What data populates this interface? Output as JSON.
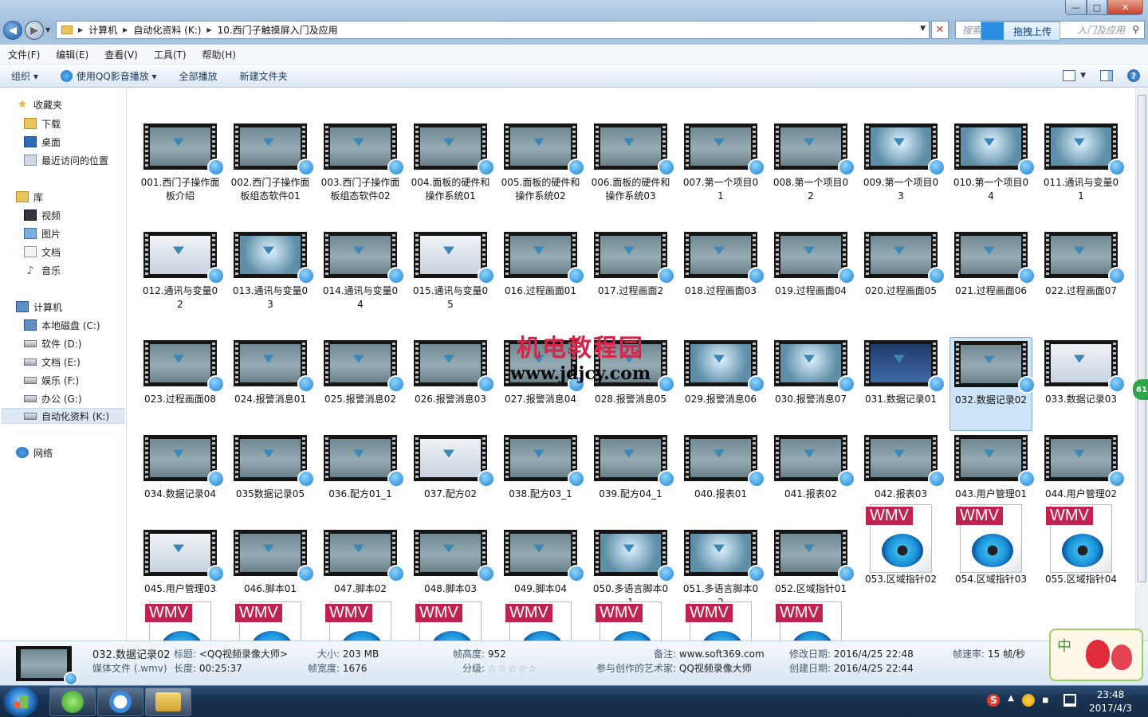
{
  "window": {
    "breadcrumb": [
      "计算机",
      "自动化资料 (K:)",
      "10.西门子触摸屏入门及应用"
    ],
    "search_placeholder": "搜索",
    "search_partial": "入门及应用",
    "upload_button": "拖拽上传",
    "controls": {
      "minimize": "—",
      "maximize": "□",
      "close": "✕"
    }
  },
  "menubar": [
    "文件(F)",
    "编辑(E)",
    "查看(V)",
    "工具(T)",
    "帮助(H)"
  ],
  "cmdbar": {
    "organize": "组织 ▾",
    "qq_play": "使用QQ影音播放 ▾",
    "play_all": "全部播放",
    "new_folder": "新建文件夹"
  },
  "navpane": {
    "favorites": {
      "label": "收藏夹",
      "items": [
        "下载",
        "桌面",
        "最近访问的位置"
      ]
    },
    "libraries": {
      "label": "库",
      "items": [
        "视频",
        "图片",
        "文档",
        "音乐"
      ]
    },
    "computer": {
      "label": "计算机",
      "items": [
        "本地磁盘 (C:)",
        "软件 (D:)",
        "文档 (E:)",
        "娱乐 (F:)",
        "办公 (G:)",
        "自动化资料 (K:)"
      ]
    },
    "network": {
      "label": "网络"
    }
  },
  "files": [
    {
      "name": "001.西门子操作面板介绍",
      "kind": "video"
    },
    {
      "name": "002.西门子操作面板组态软件01",
      "kind": "video"
    },
    {
      "name": "003.西门子操作面板组态软件02",
      "kind": "video"
    },
    {
      "name": "004.面板的硬件和操作系统01",
      "kind": "video"
    },
    {
      "name": "005.面板的硬件和操作系统02",
      "kind": "video"
    },
    {
      "name": "006.面板的硬件和操作系统03",
      "kind": "video"
    },
    {
      "name": "007.第一个项目01",
      "kind": "video"
    },
    {
      "name": "008.第一个项目02",
      "kind": "video"
    },
    {
      "name": "009.第一个项目03",
      "kind": "diamond"
    },
    {
      "name": "010.第一个项目04",
      "kind": "diamond"
    },
    {
      "name": "011.通讯与变量01",
      "kind": "diamond"
    },
    {
      "name": "012.通讯与变量02",
      "kind": "shot"
    },
    {
      "name": "013.通讯与变量03",
      "kind": "diamond"
    },
    {
      "name": "014.通讯与变量04",
      "kind": "video"
    },
    {
      "name": "015.通讯与变量05",
      "kind": "shot"
    },
    {
      "name": "016.过程画面01",
      "kind": "video"
    },
    {
      "name": "017.过程画面2",
      "kind": "video"
    },
    {
      "name": "018.过程画面03",
      "kind": "video"
    },
    {
      "name": "019.过程画面04",
      "kind": "video"
    },
    {
      "name": "020.过程画面05",
      "kind": "video"
    },
    {
      "name": "021.过程画面06",
      "kind": "video"
    },
    {
      "name": "022.过程画面07",
      "kind": "video"
    },
    {
      "name": "023.过程画面08",
      "kind": "video"
    },
    {
      "name": "024.报警消息01",
      "kind": "video"
    },
    {
      "name": "025.报警消息02",
      "kind": "video"
    },
    {
      "name": "026.报警消息03",
      "kind": "video"
    },
    {
      "name": "027.报警消息04",
      "kind": "video"
    },
    {
      "name": "028.报警消息05",
      "kind": "video"
    },
    {
      "name": "029.报警消息06",
      "kind": "diamond"
    },
    {
      "name": "030.报警消息07",
      "kind": "diamond"
    },
    {
      "name": "031.数据记录01",
      "kind": "dark"
    },
    {
      "name": "032.数据记录02",
      "kind": "video",
      "selected": true
    },
    {
      "name": "033.数据记录03",
      "kind": "shot"
    },
    {
      "name": "034.数据记录04",
      "kind": "video"
    },
    {
      "name": "035数据记录05",
      "kind": "video"
    },
    {
      "name": "036.配方01_1",
      "kind": "video"
    },
    {
      "name": "037.配方02",
      "kind": "shot"
    },
    {
      "name": "038.配方03_1",
      "kind": "video"
    },
    {
      "name": "039.配方04_1",
      "kind": "video"
    },
    {
      "name": "040.报表01",
      "kind": "video"
    },
    {
      "name": "041.报表02",
      "kind": "video"
    },
    {
      "name": "042.报表03",
      "kind": "video"
    },
    {
      "name": "043.用户管理01",
      "kind": "video"
    },
    {
      "name": "044.用户管理02",
      "kind": "video"
    },
    {
      "name": "045.用户管理03",
      "kind": "shot"
    },
    {
      "name": "046.脚本01",
      "kind": "video"
    },
    {
      "name": "047.脚本02",
      "kind": "video"
    },
    {
      "name": "048.脚本03",
      "kind": "video"
    },
    {
      "name": "049.脚本04",
      "kind": "video"
    },
    {
      "name": "050.多语言脚本01",
      "kind": "diamond"
    },
    {
      "name": "051.多语言脚本02",
      "kind": "diamond"
    },
    {
      "name": "052.区域指针01",
      "kind": "video"
    },
    {
      "name": "053.区域指针02",
      "kind": "wmv"
    },
    {
      "name": "054.区域指针03",
      "kind": "wmv"
    },
    {
      "name": "055.区域指针04",
      "kind": "wmv"
    },
    {
      "name": "",
      "kind": "wmv"
    },
    {
      "name": "",
      "kind": "wmv"
    },
    {
      "name": "",
      "kind": "wmv"
    },
    {
      "name": "",
      "kind": "wmv"
    },
    {
      "name": "",
      "kind": "wmv"
    },
    {
      "name": "",
      "kind": "wmv"
    },
    {
      "name": "",
      "kind": "wmv"
    },
    {
      "name": "",
      "kind": "wmv"
    }
  ],
  "wmv_tag": "WMV",
  "watermark": {
    "title": "机电教程园",
    "url": "www.jdjcy.com"
  },
  "side_badge": "61",
  "details": {
    "name": "032.数据记录02",
    "type": "媒体文件 (.wmv)",
    "title_label": "标题:",
    "title_value": "<QQ视频录像大师>",
    "length_label": "长度:",
    "length_value": "00:25:37",
    "size_label": "大小:",
    "size_value": "203 MB",
    "frame_width_label": "帧宽度:",
    "frame_width_value": "1676",
    "frame_height_label": "帧高度:",
    "frame_height_value": "952",
    "rating_label": "分级:",
    "rating_stars": "☆☆☆☆☆",
    "comment_label": "备注:",
    "comment_value": "www.soft369.com",
    "artist_label": "参与创作的艺术家:",
    "artist_value": "QQ视频录像大师",
    "modified_label": "修改日期:",
    "modified_value": "2016/4/25 22:48",
    "created_label": "创建日期:",
    "created_value": "2016/4/25 22:44",
    "framerate_label": "帧速率:",
    "framerate_value": "15 帧/秒"
  },
  "ime": {
    "label": "中"
  },
  "taskbar": {
    "time": "23:48",
    "date": "2017/4/3",
    "tray_s": "S"
  }
}
